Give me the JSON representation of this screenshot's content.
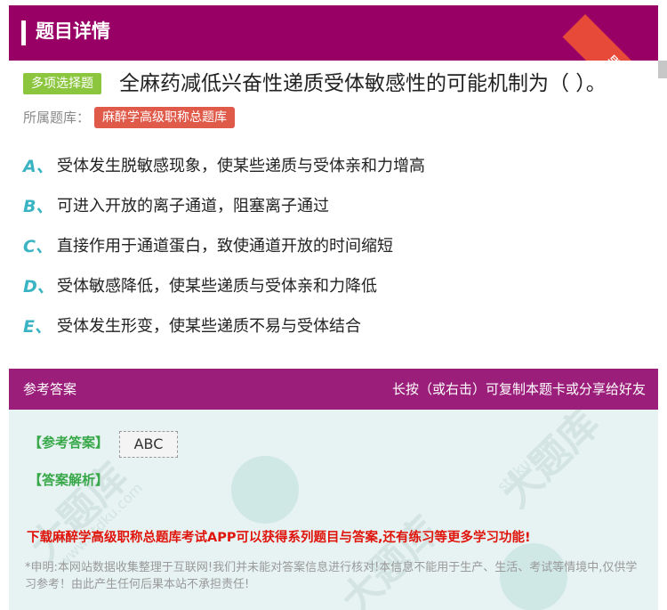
{
  "header": {
    "title": "题目详情",
    "ribbon_label": "题卡"
  },
  "question": {
    "type_tag": "多项选择题",
    "text": "全麻药减低兴奋性递质受体敏感性的可能机制为（ ）。",
    "bank_label": "所属题库：",
    "bank_name": "麻醉学高级职称总题库"
  },
  "options": [
    {
      "letter": "A、",
      "text": "受体发生脱敏感现象，使某些递质与受体亲和力增高"
    },
    {
      "letter": "B、",
      "text": "可进入开放的离子通道，阻塞离子通过"
    },
    {
      "letter": "C、",
      "text": "直接作用于通道蛋白，致使通道开放的时间缩短"
    },
    {
      "letter": "D、",
      "text": "受体敏感降低，使某些递质与受体亲和力降低"
    },
    {
      "letter": "E、",
      "text": "受体发生形变，使某些递质不易与受体结合"
    }
  ],
  "answer_section": {
    "title": "参考答案",
    "hint": "长按（或右击）可复制本题卡或分享给好友",
    "reference_label": "【参考答案】",
    "reference_value": "ABC",
    "analysis_label": "【答案解析】",
    "promo": "下载麻醉学高级职称总题库考试APP可以获得系列题目与答案,还有练习等更多学习功能!",
    "disclaimer": "*申明:本网站数据收集整理于互联网!我们并未能对答案信息进行核对!本信息不能用于生产、生活、考试等情境中,仅供学习参考！由此产生任何后果本站不承担责任!"
  },
  "colors": {
    "header_bg": "#990066",
    "ribbon": "#e84a3a",
    "type_tag": "#8cc63f",
    "bank_tag": "#e05a4a",
    "option_letter": "#3ab3c2",
    "answer_bar": "#9b1e7b",
    "answer_bg": "#e6f3f2",
    "label_green": "#37a748",
    "promo_red": "#e0140b"
  }
}
